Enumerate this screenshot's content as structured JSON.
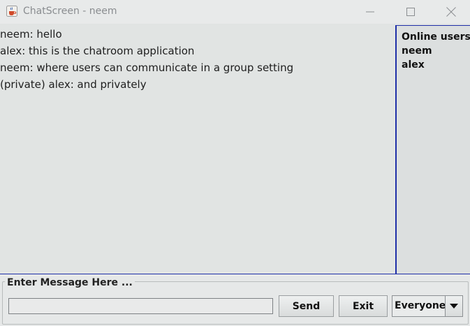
{
  "window": {
    "title": "ChatScreen - neem",
    "icons": {
      "app": "java-cup-icon",
      "minimize": "minimize-icon",
      "maximize": "maximize-icon",
      "close": "close-icon"
    },
    "colors": {
      "title_text": "#8a8d90",
      "panel_border": "#1f2fa8"
    }
  },
  "chat": {
    "messages": [
      "neem: hello",
      "alex: this is the chatroom application",
      "neem: where users can communicate in a group setting",
      "(private) alex: and privately"
    ]
  },
  "users_panel": {
    "header": "Online users:",
    "users": [
      "neem",
      "alex"
    ]
  },
  "compose": {
    "group_label": "Enter Message Here ...",
    "input_value": "",
    "send_label": "Send",
    "exit_label": "Exit",
    "recipient_selected": "Everyone",
    "dropdown_icon": "triangle-down-icon"
  }
}
